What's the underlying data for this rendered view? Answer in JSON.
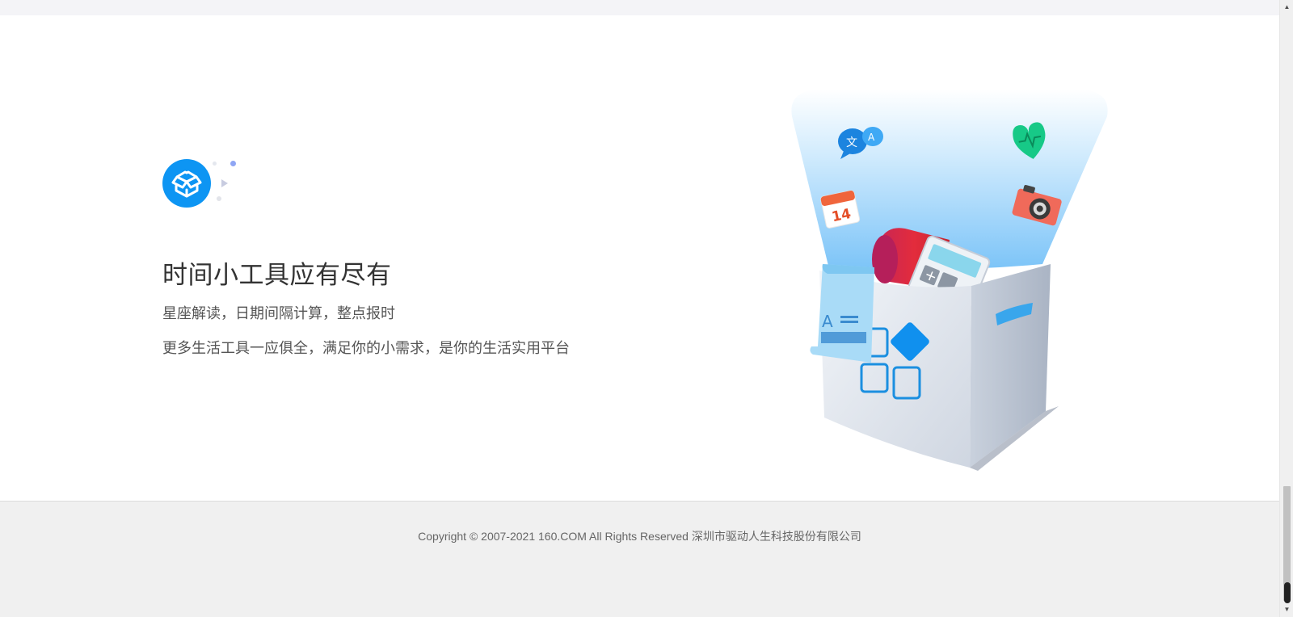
{
  "feature": {
    "title": "时间小工具应有尽有",
    "line1": "星座解读，日期间隔计算，整点报时",
    "line2": "更多生活工具一应俱全，满足你的小需求，是你的生活实用平台",
    "logo_icon": "open-box-icon"
  },
  "illustration": {
    "calendar_day": "14",
    "translate_glyph_zh": "文",
    "translate_glyph_en": "A",
    "ticket_letter": "A"
  },
  "footer": {
    "copyright": "Copyright © 2007-2021 160.COM All Rights Reserved 深圳市驱动人生科技股份有限公司"
  },
  "colors": {
    "accent": "#0d95f3",
    "title": "#333333",
    "text": "#555555",
    "footer_bg": "#f0f0f0"
  }
}
